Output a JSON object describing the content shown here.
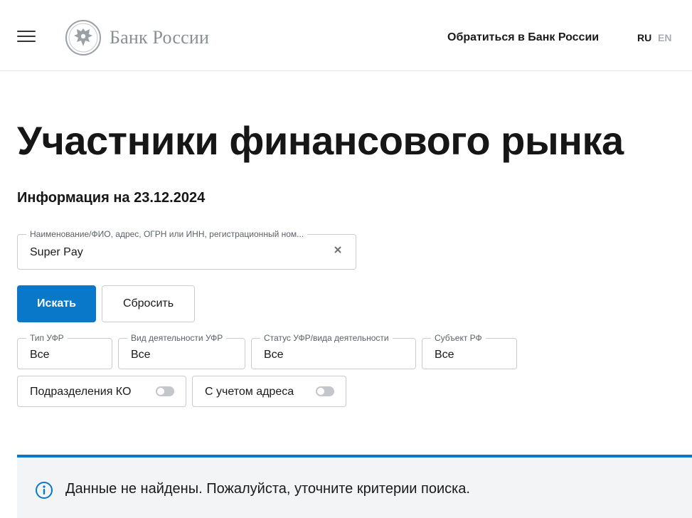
{
  "header": {
    "logo_text": "Банк России",
    "contact_link": "Обратиться в Банк России",
    "lang_ru": "RU",
    "lang_en": "EN"
  },
  "main": {
    "title": "Участники финансового рынка",
    "info_date": "Информация на 23.12.2024"
  },
  "search": {
    "label": "Наименование/ФИО, адрес, ОГРН или ИНН, регистрационный ном...",
    "value": "Super Pay"
  },
  "buttons": {
    "search_label": "Искать",
    "reset_label": "Сбросить"
  },
  "filters": [
    {
      "label": "Тип УФР",
      "value": "Все"
    },
    {
      "label": "Вид деятельности УФР",
      "value": "Все"
    },
    {
      "label": "Статус УФР/вида деятельности",
      "value": "Все"
    },
    {
      "label": "Субъект РФ",
      "value": "Все"
    }
  ],
  "toggles": [
    {
      "label": "Подразделения КО",
      "on": false
    },
    {
      "label": "С учетом адреса",
      "on": false
    }
  ],
  "notice": {
    "text": "Данные не найдены. Пожалуйста, уточните критерии поиска."
  },
  "colors": {
    "accent": "#0a78c8",
    "border": "#c9cdd1",
    "notice_bg": "#f2f4f5"
  }
}
